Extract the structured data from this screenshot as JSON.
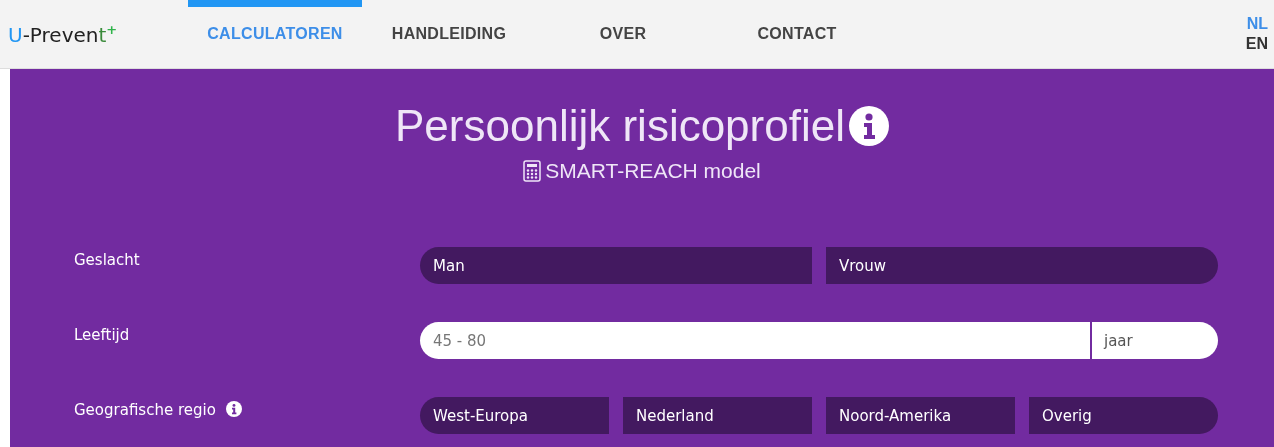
{
  "logo": {
    "main": "U-Preven",
    "tail": "t",
    "plus": "+"
  },
  "nav": [
    {
      "label": "CALCULATOREN",
      "selected": true
    },
    {
      "label": "HANDLEIDING",
      "selected": false
    },
    {
      "label": "OVER",
      "selected": false
    },
    {
      "label": "CONTACT",
      "selected": false
    }
  ],
  "languages": [
    {
      "label": "NL",
      "selected": true
    },
    {
      "label": "EN",
      "selected": false
    }
  ],
  "title": "Persoonlijk risicoprofiel",
  "subtitle": "SMART-REACH model",
  "fields": [
    {
      "kind": "options",
      "label": "Geslacht",
      "info": false,
      "options": [
        {
          "label": "Man",
          "selected": false
        },
        {
          "label": "Vrouw",
          "selected": false
        }
      ]
    },
    {
      "kind": "number",
      "label": "Leeftijd",
      "info": false,
      "placeholder": "45 - 80",
      "unit": "jaar"
    },
    {
      "kind": "options",
      "label": "Geografische regio",
      "info": true,
      "options": [
        {
          "label": "West-Europa",
          "selected": false
        },
        {
          "label": "Nederland",
          "selected": false
        },
        {
          "label": "Noord-Amerika",
          "selected": false
        },
        {
          "label": "Overig",
          "selected": false
        }
      ]
    }
  ]
}
